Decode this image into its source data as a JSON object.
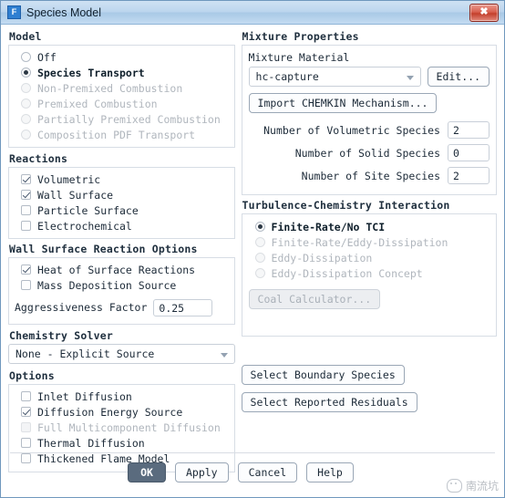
{
  "window": {
    "title": "Species Model",
    "app_icon": "fluent-icon",
    "icon_letter": "F",
    "close_label": "✖"
  },
  "model": {
    "title": "Model",
    "options": [
      {
        "label": "Off",
        "selected": false,
        "disabled": false
      },
      {
        "label": "Species Transport",
        "selected": true,
        "disabled": false
      },
      {
        "label": "Non-Premixed Combustion",
        "selected": false,
        "disabled": true
      },
      {
        "label": "Premixed Combustion",
        "selected": false,
        "disabled": true
      },
      {
        "label": "Partially Premixed Combustion",
        "selected": false,
        "disabled": true
      },
      {
        "label": "Composition PDF Transport",
        "selected": false,
        "disabled": true
      }
    ]
  },
  "reactions": {
    "title": "Reactions",
    "options": [
      {
        "label": "Volumetric",
        "checked": true,
        "disabled": false
      },
      {
        "label": "Wall Surface",
        "checked": true,
        "disabled": false
      },
      {
        "label": "Particle Surface",
        "checked": false,
        "disabled": false
      },
      {
        "label": "Electrochemical",
        "checked": false,
        "disabled": false
      }
    ]
  },
  "wall_surface_options": {
    "title": "Wall Surface Reaction Options",
    "options": [
      {
        "label": "Heat of Surface Reactions",
        "checked": true,
        "disabled": false
      },
      {
        "label": "Mass Deposition Source",
        "checked": false,
        "disabled": false
      }
    ],
    "aggressiveness_label": "Aggressiveness Factor",
    "aggressiveness_value": "0.25"
  },
  "chemistry_solver": {
    "title": "Chemistry Solver",
    "selected": "None - Explicit Source"
  },
  "options_group": {
    "title": "Options",
    "options": [
      {
        "label": "Inlet Diffusion",
        "checked": false,
        "disabled": false
      },
      {
        "label": "Diffusion Energy Source",
        "checked": true,
        "disabled": false
      },
      {
        "label": "Full Multicomponent Diffusion",
        "checked": false,
        "disabled": true
      },
      {
        "label": "Thermal Diffusion",
        "checked": false,
        "disabled": false
      },
      {
        "label": "Thickened Flame Model",
        "checked": false,
        "disabled": false
      }
    ]
  },
  "mixture": {
    "title": "Mixture Properties",
    "material_label": "Mixture Material",
    "material_value": "hc-capture",
    "edit_label": "Edit...",
    "import_label": "Import CHEMKIN Mechanism...",
    "counts": [
      {
        "label": "Number of Volumetric Species",
        "value": "2"
      },
      {
        "label": "Number of Solid Species",
        "value": "0"
      },
      {
        "label": "Number of Site Species",
        "value": "2"
      }
    ]
  },
  "tci": {
    "title": "Turbulence-Chemistry Interaction",
    "options": [
      {
        "label": "Finite-Rate/No TCI",
        "selected": true,
        "disabled": false
      },
      {
        "label": "Finite-Rate/Eddy-Dissipation",
        "selected": false,
        "disabled": true
      },
      {
        "label": "Eddy-Dissipation",
        "selected": false,
        "disabled": true
      },
      {
        "label": "Eddy-Dissipation Concept",
        "selected": false,
        "disabled": true
      }
    ],
    "coal_calculator_label": "Coal Calculator..."
  },
  "side_actions": {
    "boundary_species_label": "Select Boundary Species",
    "reported_residuals_label": "Select Reported Residuals"
  },
  "footer": {
    "ok_label": "OK",
    "apply_label": "Apply",
    "cancel_label": "Cancel",
    "help_label": "Help"
  },
  "watermark": {
    "icon": "wechat-icon",
    "text": "南流坑"
  }
}
